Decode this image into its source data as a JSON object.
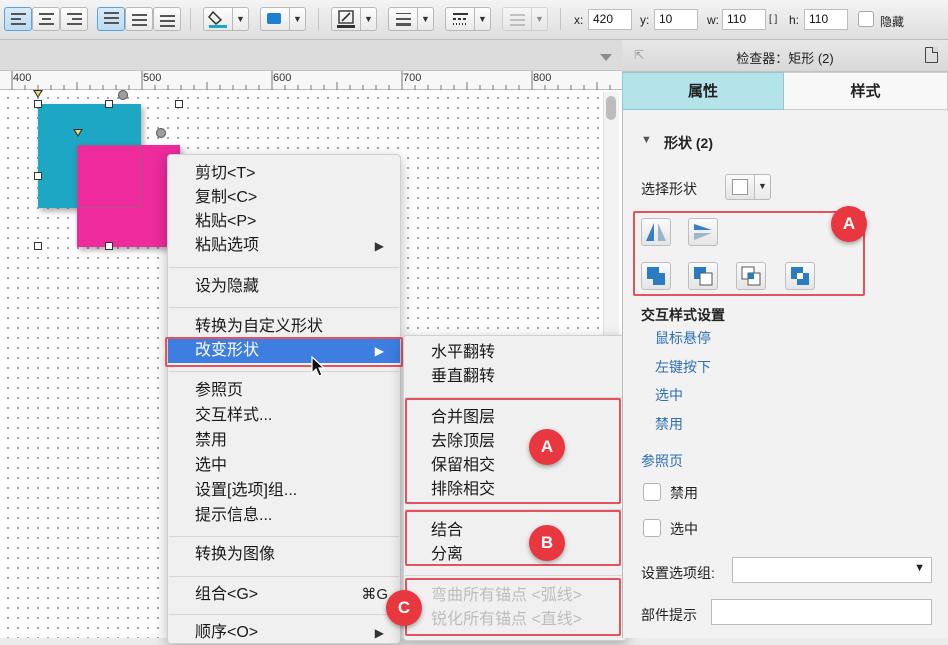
{
  "toolbar": {
    "x_label": "x:",
    "x_value": "420",
    "y_label": "y:",
    "y_value": "10",
    "w_label": "w:",
    "w_value": "110",
    "lock_label": "[ ]",
    "h_label": "h:",
    "h_value": "110",
    "hidden_label": "隐藏"
  },
  "ruler": {
    "marks": [
      "400",
      "500",
      "600",
      "700",
      "800"
    ]
  },
  "shapes": {
    "teal_color": "#1ea7c5",
    "pink_color": "#ee2a9c"
  },
  "context_menu": {
    "cut": "剪切<T>",
    "copy": "复制<C>",
    "paste": "粘贴<P>",
    "paste_options": "粘贴选项",
    "set_hidden": "设为隐藏",
    "convert_custom_shape": "转换为自定义形状",
    "change_shape": "改变形状",
    "reference_page": "参照页",
    "interaction_styles": "交互样式...",
    "disabled": "禁用",
    "selected": "选中",
    "set_option_group": "设置[选项]组...",
    "tooltip": "提示信息...",
    "convert_image": "转换为图像",
    "group": "组合<G>",
    "group_shortcut": "⌘G",
    "order": "顺序<O>"
  },
  "submenu": {
    "flip_horizontal": "水平翻转",
    "flip_vertical": "垂直翻转",
    "union": "合并图层",
    "subtract": "去除顶层",
    "intersect": "保留相交",
    "exclude": "排除相交",
    "combine": "结合",
    "separate": "分离",
    "curve_all": "弯曲所有锚点 <弧线>",
    "sharpen_all": "锐化所有锚点 <直线>"
  },
  "badges": {
    "a": "A",
    "b": "B",
    "c": "C"
  },
  "inspector": {
    "title": "检查器：矩形 (2)",
    "tab_properties": "属性",
    "tab_style": "样式",
    "section_shape": "形状 (2)",
    "select_shape_label": "选择形状",
    "interaction_title": "交互样式设置",
    "link_hover": "鼠标悬停",
    "link_mousedown": "左键按下",
    "link_selected": "选中",
    "link_disabled": "禁用",
    "reference_page": "参照页",
    "disabled_label": "禁用",
    "selected_label": "选中",
    "option_group_label": "设置选项组:",
    "tooltip_label": "部件提示"
  }
}
